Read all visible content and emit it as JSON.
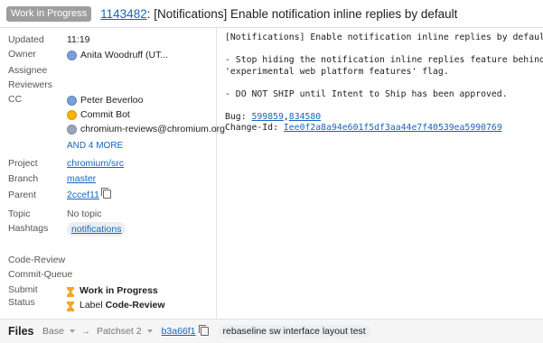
{
  "header": {
    "status": "Work in Progress",
    "change_number": "1143482",
    "title_rest": ": [Notifications] Enable notification inline replies by default"
  },
  "meta": {
    "updated": {
      "label": "Updated",
      "value": "11:19"
    },
    "owner": {
      "label": "Owner",
      "value": "Anita Woodruff (UT..."
    },
    "assignee": {
      "label": "Assignee"
    },
    "reviewers": {
      "label": "Reviewers"
    },
    "cc": {
      "label": "CC",
      "people": [
        "Peter Beverloo",
        "Commit Bot",
        "chromium-reviews@chromium.org"
      ],
      "more": "AND 4 MORE"
    },
    "project": {
      "label": "Project",
      "value": "chromium/src"
    },
    "branch": {
      "label": "Branch",
      "value": "master"
    },
    "parent": {
      "label": "Parent",
      "value": "2ccef11"
    },
    "topic": {
      "label": "Topic",
      "value": "No topic"
    },
    "hashtags": {
      "label": "Hashtags",
      "value": "notifications"
    },
    "code_review": {
      "label": "Code-Review"
    },
    "commit_queue": {
      "label": "Commit-Queue"
    },
    "submit_status": {
      "label": "Submit Status",
      "line1": "Work in Progress",
      "line2_prefix": "Label ",
      "line2_bold": "Code-Review"
    }
  },
  "message": {
    "subject": "[Notifications] Enable notification inline replies by default",
    "para1_line1": "- Stop hiding the notification inline replies feature behind the",
    "para1_line2": "'experimental web platform features' flag.",
    "para2": "- DO NOT SHIP until Intent to Ship has been approved.",
    "bug_label": "Bug: ",
    "bug1": "599859",
    "bug_sep": ",",
    "bug2": "834580",
    "changeid_label": "Change-Id: ",
    "changeid": "Iee0f2a8a94e601f5df3aa44e7f40539ea5990769"
  },
  "footer": {
    "title": "Files",
    "base": "Base",
    "arrow": "→",
    "patchset": "Patchset 2",
    "commit": "b3a66f1",
    "subject": "rebaseline sw interface layout test"
  },
  "colors": {
    "link": "#1565c0",
    "status_chip": "#9e9e9e",
    "hourglass": "#f5a623"
  }
}
